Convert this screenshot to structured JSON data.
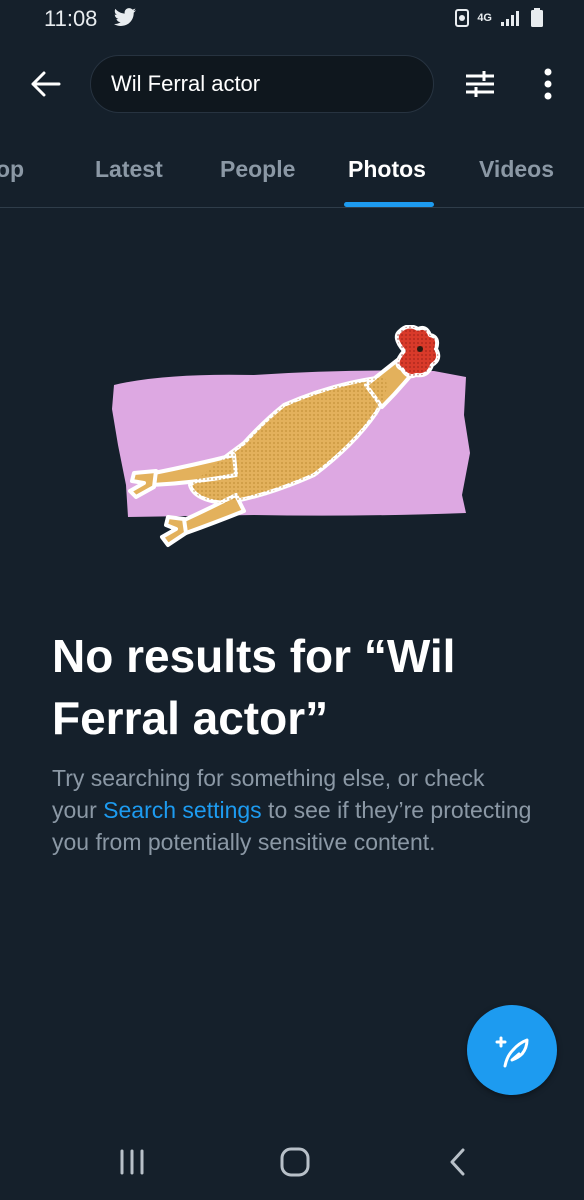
{
  "status_bar": {
    "time": "11:08",
    "icons": [
      "twitter-bird-icon",
      "data-saver-icon",
      "4g-icon",
      "signal-icon",
      "battery-icon"
    ],
    "network_label": "4G"
  },
  "search": {
    "query": "Wil Ferral actor"
  },
  "tabs": [
    {
      "label": "op",
      "active": false
    },
    {
      "label": "Latest",
      "active": false
    },
    {
      "label": "People",
      "active": false
    },
    {
      "label": "Photos",
      "active": true
    },
    {
      "label": "Videos",
      "active": false
    }
  ],
  "empty_state": {
    "title": "No results for “Wil Ferral actor”",
    "body_prefix": "Try searching for something else, or check your ",
    "body_link": "Search settings",
    "body_suffix": " to see if they’re protecting you from potentially sensitive content."
  },
  "colors": {
    "background": "#15202b",
    "accent": "#1d9bf0",
    "secondary_text": "#8b98a5",
    "illustration_bg": "#dda8e2"
  }
}
